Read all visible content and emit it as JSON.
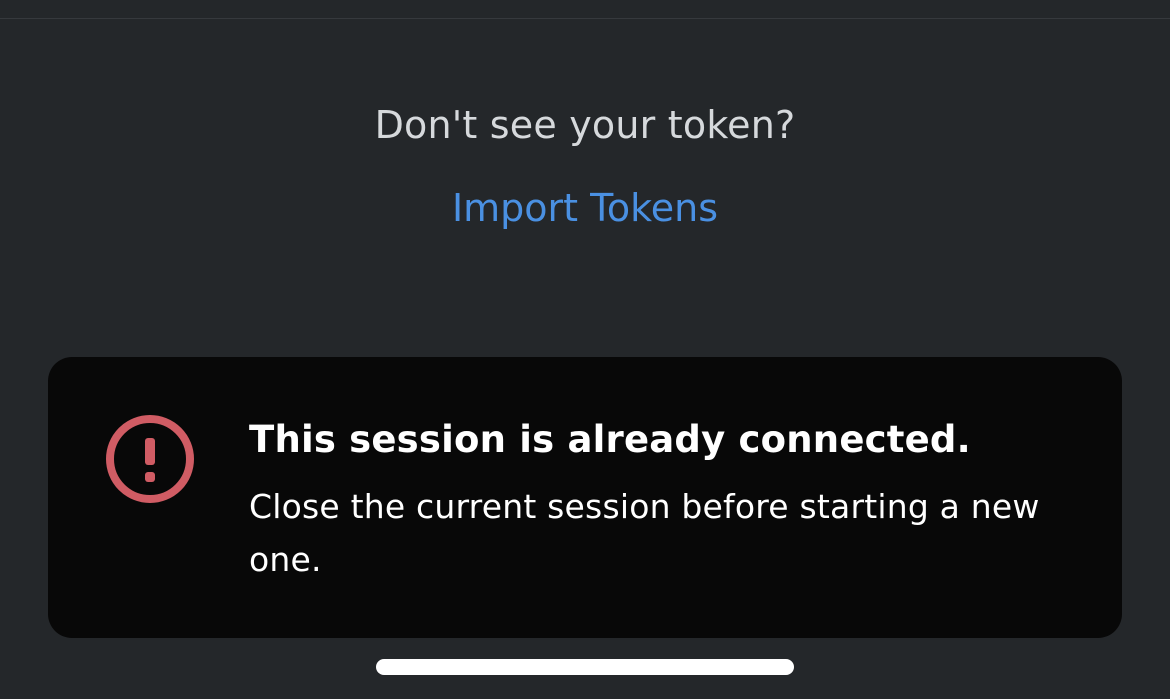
{
  "token_prompt": {
    "question": "Don't see your token?",
    "link_label": "Import Tokens"
  },
  "toast": {
    "icon": "error-exclamation-icon",
    "title": "This session is already connected.",
    "message": "Close the current session before starting a new one."
  },
  "colors": {
    "background": "#24272a",
    "link": "#4a90e2",
    "toast_background": "#080808",
    "error": "#d73a49"
  }
}
